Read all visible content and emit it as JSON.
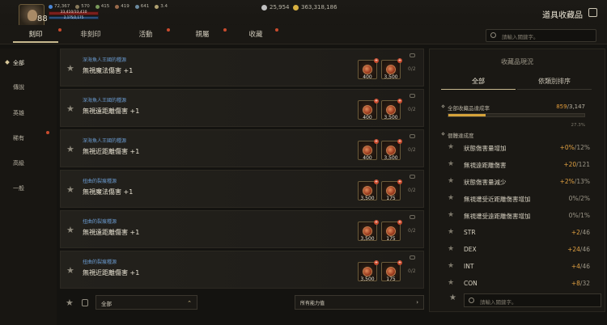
{
  "player": {
    "level": "88",
    "stats": [
      "72,367",
      "570",
      "415",
      "419",
      "641",
      "3.4"
    ],
    "hp": "33,410/33,410",
    "mp": "2,175/2,175"
  },
  "currency": {
    "silver": "25,954",
    "gold": "363,318,186"
  },
  "page_title": "道具收藏品",
  "tabs": [
    "刻印",
    "非刻印",
    "活動",
    "親屬",
    "收藏"
  ],
  "search_placeholder": "請輸入關鍵字。",
  "sidebar": [
    "全部",
    "傳說",
    "英雄",
    "稀有",
    "高級",
    "一般"
  ],
  "rows": [
    {
      "sub": "深海魚人王國的種源",
      "name": "無視魔法傷害 +1",
      "items": [
        "400",
        "3,500"
      ],
      "ratio": "0/2"
    },
    {
      "sub": "深海魚人王國的種源",
      "name": "無視遠距離傷害 +1",
      "items": [
        "400",
        "3,500"
      ],
      "ratio": "0/2"
    },
    {
      "sub": "深海魚人王國的種源",
      "name": "無視近距離傷害 +1",
      "items": [
        "400",
        "3,500"
      ],
      "ratio": "0/2"
    },
    {
      "sub": "扭曲的裂痕種源",
      "name": "無視魔法傷害 +1",
      "items": [
        "3,500",
        "175"
      ],
      "ratio": "0/2"
    },
    {
      "sub": "扭曲的裂痕種源",
      "name": "無視遠距離傷害 +1",
      "items": [
        "3,500",
        "175"
      ],
      "ratio": "0/2"
    },
    {
      "sub": "扭曲的裂痕種源",
      "name": "無視近距離傷害 +1",
      "items": [
        "3,500",
        "175"
      ],
      "ratio": "0/2"
    }
  ],
  "footer": {
    "dropdown": "全部",
    "filter": "所有能力值"
  },
  "panel": {
    "title": "收藏品現況",
    "tabs": [
      "全部",
      "依類別排序"
    ],
    "progress_label": "全部收藏品達成率",
    "progress_current": "859",
    "progress_total": "/3,147",
    "progress_fraction": 0.273,
    "progress_pct": "27.3%",
    "section_label": "個體達成度",
    "stats": [
      {
        "name": "狀態傷害量增加",
        "cur": "+0%",
        "max": "/12%"
      },
      {
        "name": "無視遠距離傷害",
        "cur": "+20",
        "max": "/121"
      },
      {
        "name": "狀態傷害量減少",
        "cur": "+2%",
        "max": "/13%"
      },
      {
        "name": "無視遭受近距離傷害增加",
        "cur": "0%",
        "max": "/2%"
      },
      {
        "name": "無視遭受遠距離傷害增加",
        "cur": "0%",
        "max": "/1%"
      },
      {
        "name": "STR",
        "cur": "+2",
        "max": "/46"
      },
      {
        "name": "DEX",
        "cur": "+24",
        "max": "/46"
      },
      {
        "name": "INT",
        "cur": "+4",
        "max": "/46"
      },
      {
        "name": "CON",
        "cur": "+8",
        "max": "/32"
      }
    ]
  }
}
